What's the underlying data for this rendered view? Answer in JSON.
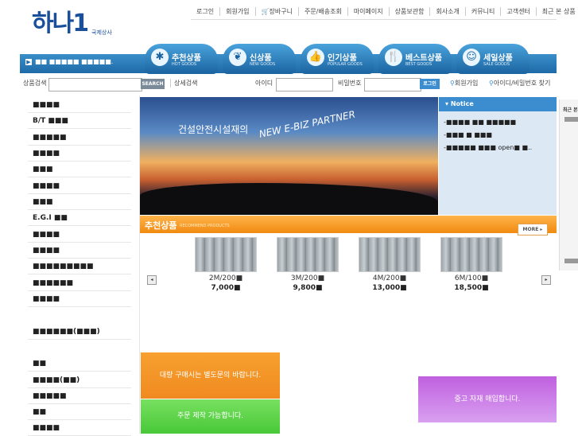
{
  "logo": {
    "main": "하나1",
    "sub": "국제상사"
  },
  "topnav": [
    "로그인",
    "회원가입",
    "🛒장바구니",
    "주문/배송조회",
    "마이페이지",
    "상품보관함",
    "회사소개",
    "커뮤니티",
    "고객센터",
    "최근 본 상품"
  ],
  "ticker": "■■ ■■■■■ ■■■■■.",
  "tabs": [
    {
      "label": "추천상품",
      "en": "HOT GOODS",
      "icon": "✱"
    },
    {
      "label": "신상품",
      "en": "NEW GOODS",
      "icon": "❦"
    },
    {
      "label": "인기상품",
      "en": "POPULAR GOODS",
      "icon": "👍"
    },
    {
      "label": "베스트상품",
      "en": "BEST GOODS",
      "icon": "🍴"
    },
    {
      "label": "세일상품",
      "en": "SALE GOODS",
      "icon": "☺"
    }
  ],
  "search": {
    "label": "상품검색",
    "button": "SEARCH",
    "detail": "상세검색",
    "id_label": "아이디",
    "pw_label": "비밀번호",
    "login_button": "로그인",
    "join": "회원가입",
    "find": "아이디/비밀번호 찾기"
  },
  "sidebar": [
    "■■■■",
    "B/T ■■■",
    "■■■■■",
    "■■■■",
    "■■■",
    "■■■■",
    "■■■",
    "E.G.I ■■",
    "■■■■",
    "■■■■",
    "■■■■■■■■■",
    "■■■■■■",
    "■■■■",
    "■■■■■■(■■■)",
    "■■",
    "■■■■(■■)",
    "■■■■■",
    "■■",
    "■■■■"
  ],
  "banner": {
    "line1": "건설안전시설재의",
    "line2": "NEW E-BIZ PARTNER"
  },
  "notice": {
    "title": "Notice",
    "items": [
      "-■■■■ ■■ ■■■■■",
      "-■■■ ■ ■■■",
      "-■■■■■ ■■■ open■ ■.."
    ]
  },
  "recommend": {
    "title": "추천상품",
    "en": "RECOMMEND PRODUCTS",
    "more": "MORE ▸"
  },
  "products": [
    {
      "name": "2M/200■",
      "price": "7,000■"
    },
    {
      "name": "3M/200■",
      "price": "9,800■"
    },
    {
      "name": "4M/200■",
      "price": "13,000■"
    },
    {
      "name": "6M/100■",
      "price": "18,500■"
    }
  ],
  "arrows": {
    "left": "◂",
    "right": "▸"
  },
  "bottom_banners": [
    "대량 구매시는 별도문의 바랍니다.",
    "주문 제작 가능합니다.",
    "중고 자재 매입합니다."
  ],
  "right_panel": {
    "title": "최근 본 상품"
  }
}
